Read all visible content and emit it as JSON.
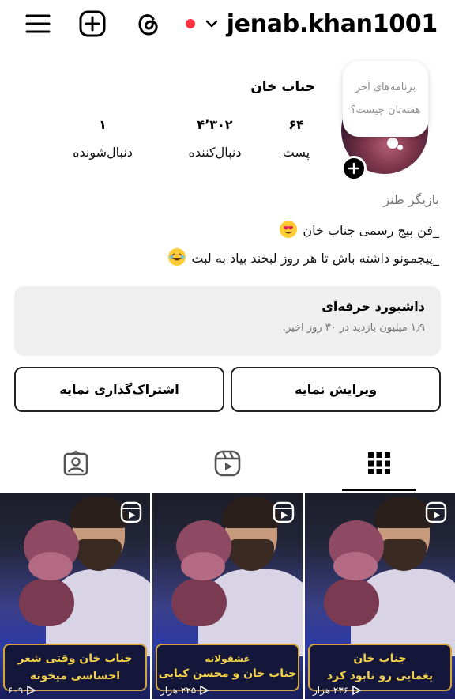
{
  "header": {
    "username": "jenab.khan1001",
    "icons": [
      "menu-icon",
      "add-icon",
      "threads-icon",
      "chevron-down-icon"
    ],
    "status_dot_color": "#ff3040"
  },
  "profile": {
    "display_name": "جناب خان",
    "note": "برنامه‌های آخر هفته‌تان چیست؟",
    "stats": {
      "posts": {
        "value": "۶۴",
        "label": "پست"
      },
      "followers": {
        "value": "۴٬۳۰۲",
        "label": "دنبال‌کننده"
      },
      "following": {
        "value": "۱",
        "label": "دنبال‌شونده"
      }
    },
    "bio": {
      "category": "بازیگر طنز",
      "line1": "_فن پیج رسمی جناب خان",
      "line2": "_پیجمونو داشته باش تا هر روز لبخند بیاد به لبت"
    }
  },
  "dashboard": {
    "title": "داشبورد حرفه‌ای",
    "subtitle": "۱٫۹ میلیون بازدید در ۳۰ روز اخیر."
  },
  "buttons": {
    "edit": "ویرایش نمایه",
    "share": "اشتراک‌گذاری نمایه"
  },
  "tabs": [
    "grid-icon",
    "reels-icon",
    "tagged-icon"
  ],
  "posts": [
    {
      "line1": "جناب خان",
      "line2": "یغمایی رو نابود کرد",
      "views": "۲۳۶ هزار"
    },
    {
      "small": "عشقولانه",
      "line2": "جناب خان و محسن کیایی",
      "views": "۲۲۵ هزار"
    },
    {
      "line1": "جناب خان وقتی شعر",
      "line2": "احساسی میخونه",
      "views": "۶۰۹"
    }
  ],
  "colors": {
    "accent": "#000000",
    "caption_text": "#f2d24a",
    "caption_border": "#d4a53a"
  }
}
